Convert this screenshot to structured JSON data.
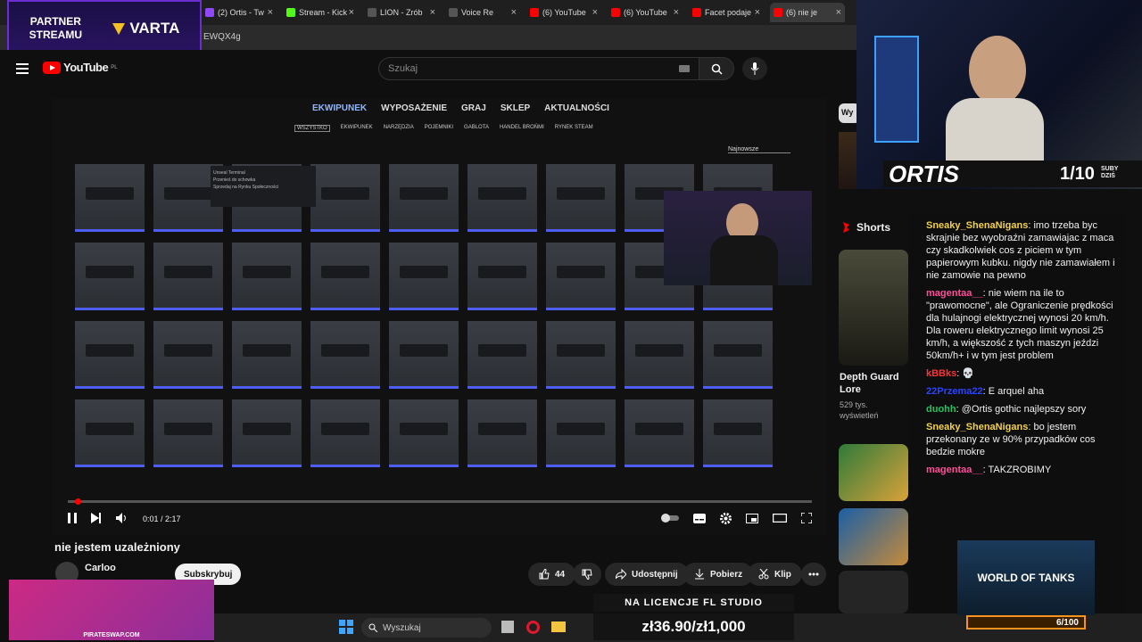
{
  "browser": {
    "tabs": [
      {
        "label": "(2) Ortis - Tw",
        "color": "#9146ff"
      },
      {
        "label": "Stream - Kick",
        "color": "#53fc18"
      },
      {
        "label": "LION - Zrób",
        "color": "#555555"
      },
      {
        "label": "Voice Re",
        "color": "#555555"
      },
      {
        "label": "(6) YouTube",
        "color": "#ff0000"
      },
      {
        "label": "(6) YouTube",
        "color": "#ff0000"
      },
      {
        "label": "Facet podaje",
        "color": "#ff0000"
      },
      {
        "label": "(6) nie je",
        "color": "#ff0000"
      }
    ],
    "url_fragment": "EWQX4g"
  },
  "partner": {
    "line1": "PARTNER",
    "line2": "STREAMU",
    "brand": "VARTA"
  },
  "youtube": {
    "logo": "YouTube",
    "region": "PL",
    "search_placeholder": "Szukaj"
  },
  "game": {
    "nav": [
      "EKWIPUNEK",
      "WYPOSAŻENIE",
      "GRAJ",
      "SKLEP",
      "AKTUALNOŚCI"
    ],
    "filters": [
      "WSZYSTKO",
      "EKWIPUNEK",
      "NARZĘDZIA",
      "POJEMNIKI",
      "GABLOTA",
      "HANDEL BROŃMI",
      "RYNEK STEAM"
    ],
    "sort": "Najnowsze",
    "menu": [
      "Unseal Terminal",
      "Przenieś do schowka",
      "Sprzedaj na Rynku Społeczności"
    ]
  },
  "player": {
    "time": "0:01 / 2:17",
    "progress": 0.01
  },
  "video": {
    "title": "nie jestem uzależniony",
    "channel": "Carloo",
    "subscribe": "Subskrybuj",
    "likes": "44",
    "share": "Udostępnij",
    "download": "Pobierz",
    "clip": "Klip"
  },
  "stream": {
    "name": "ORTIS",
    "subs_count": "1/10",
    "subs_label": "SUBY DZIŚ"
  },
  "shorts": {
    "label": "Shorts",
    "first_title": "Depth Guard Lore",
    "first_views": "529 tys. wyświetleń",
    "side_label": "Wy"
  },
  "chat": [
    {
      "user": "Sneaky_ShenaNigans",
      "color": "#f2d24b",
      "text": ": imo trzeba byc skrajnie bez wyobraźni zamawiajac z maca czy skadkolwiek cos z piciem w tym papierowym kubku. nigdy nie zamawiałem i nie zamowie na pewno"
    },
    {
      "user": "magentaa__",
      "color": "#ff4d9a",
      "text": ": nie wiem na ile to \"prawomocne\", ale Ograniczenie prędkości dla hulajnogi elektrycznej wynosi 20 km/h. Dla roweru elektrycznego limit wynosi 25 km/h, a większość z tych maszyn jeździ 50km/h+ i w tym jest problem"
    },
    {
      "user": "kBBks",
      "color": "#ff3333",
      "text": ": 💀"
    },
    {
      "user": "22Przema22",
      "color": "#2a44ff",
      "text": ": E arquel aha"
    },
    {
      "user": "duohh",
      "color": "#22c55e",
      "text": ": @Ortis gothic najlepszy sory"
    },
    {
      "user": "Sneaky_ShenaNigans",
      "color": "#f2d24b",
      "text": ": bo jestem przekonany ze w 90% przypadków cos bedzie mokre"
    },
    {
      "user": "magentaa__",
      "color": "#ff4d9a",
      "text": ": TAKZROBIMY"
    }
  ],
  "overlays": {
    "pirate": "PIRATESWAP.COM",
    "fl": "NA LICENCJE FL STUDIO",
    "price": "zł36.90/zł1,000",
    "wot": "WORLD OF TANKS",
    "wot_progress": "6/100"
  },
  "taskbar": {
    "search": "Wyszukaj"
  }
}
